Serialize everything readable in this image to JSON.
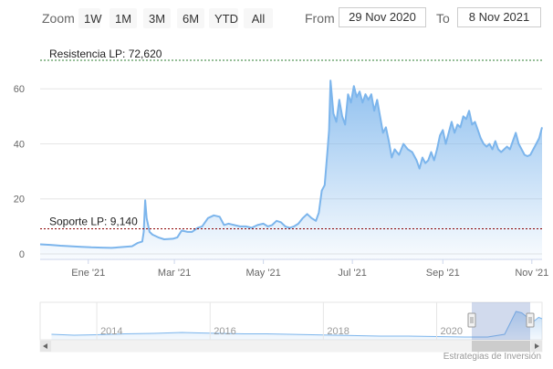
{
  "toolbar": {
    "zoom_label": "Zoom",
    "buttons": [
      "1W",
      "1M",
      "3M",
      "6M",
      "YTD",
      "All"
    ],
    "from_label": "From",
    "from_value": "29 Nov 2020",
    "to_label": "To",
    "to_value": "8 Nov 2021"
  },
  "annotations": {
    "resistance": {
      "label": "Resistencia LP: 72,620",
      "value": 72.62,
      "color": "#2e7d32"
    },
    "support": {
      "label": "Soporte LP: 9,140",
      "value": 9.14,
      "color": "#8b0000"
    }
  },
  "navigator": {
    "year_labels": [
      {
        "label": "2014",
        "year": 2014
      },
      {
        "label": "2016",
        "year": 2016
      },
      {
        "label": "2018",
        "year": 2018
      },
      {
        "label": "2020",
        "year": 2020
      }
    ],
    "history": [
      {
        "t": 2013.2,
        "v": 8
      },
      {
        "t": 2013.6,
        "v": 6
      },
      {
        "t": 2014.0,
        "v": 7
      },
      {
        "t": 2014.5,
        "v": 9
      },
      {
        "t": 2015.0,
        "v": 10
      },
      {
        "t": 2015.5,
        "v": 12
      },
      {
        "t": 2015.8,
        "v": 11
      },
      {
        "t": 2016.2,
        "v": 10
      },
      {
        "t": 2016.6,
        "v": 9
      },
      {
        "t": 2017.0,
        "v": 9
      },
      {
        "t": 2017.4,
        "v": 8
      },
      {
        "t": 2017.8,
        "v": 7
      },
      {
        "t": 2018.2,
        "v": 6
      },
      {
        "t": 2018.6,
        "v": 5
      },
      {
        "t": 2019.0,
        "v": 4
      },
      {
        "t": 2019.5,
        "v": 4
      },
      {
        "t": 2020.0,
        "v": 3
      },
      {
        "t": 2020.5,
        "v": 2
      },
      {
        "t": 2020.9,
        "v": 2
      },
      {
        "t": 2021.2,
        "v": 8
      },
      {
        "t": 2021.4,
        "v": 58
      },
      {
        "t": 2021.5,
        "v": 55
      },
      {
        "t": 2021.7,
        "v": 35
      },
      {
        "t": 2021.8,
        "v": 45
      },
      {
        "t": 2021.86,
        "v": 42
      }
    ]
  },
  "credit": "Estrategias de Inversión",
  "chart_data": {
    "type": "area",
    "x_ticks": [
      {
        "label": "Ene '21",
        "date": "2021-01-01"
      },
      {
        "label": "Mar '21",
        "date": "2021-03-01"
      },
      {
        "label": "May '21",
        "date": "2021-05-01"
      },
      {
        "label": "Jul '21",
        "date": "2021-07-01"
      },
      {
        "label": "Sep '21",
        "date": "2021-09-01"
      },
      {
        "label": "Nov '21",
        "date": "2021-11-01"
      }
    ],
    "y_ticks": [
      0,
      20,
      40,
      60
    ],
    "xlim": [
      "2020-11-29",
      "2021-11-08"
    ],
    "ylim": [
      0,
      75
    ],
    "grid": true,
    "color": "#7cb5ec",
    "points": [
      [
        "2020-11-29",
        3.5
      ],
      [
        "2020-12-06",
        3.3
      ],
      [
        "2020-12-13",
        3.0
      ],
      [
        "2020-12-20",
        2.8
      ],
      [
        "2020-12-27",
        2.6
      ],
      [
        "2021-01-03",
        2.4
      ],
      [
        "2021-01-10",
        2.3
      ],
      [
        "2021-01-17",
        2.2
      ],
      [
        "2021-01-24",
        2.5
      ],
      [
        "2021-01-31",
        2.8
      ],
      [
        "2021-02-04",
        4.0
      ],
      [
        "2021-02-07",
        4.5
      ],
      [
        "2021-02-08",
        8.0
      ],
      [
        "2021-02-09",
        19.5
      ],
      [
        "2021-02-10",
        13.0
      ],
      [
        "2021-02-12",
        8.0
      ],
      [
        "2021-02-14",
        7.0
      ],
      [
        "2021-02-18",
        6.0
      ],
      [
        "2021-02-22",
        5.3
      ],
      [
        "2021-02-28",
        5.5
      ],
      [
        "2021-03-03",
        6.0
      ],
      [
        "2021-03-06",
        8.5
      ],
      [
        "2021-03-10",
        8.0
      ],
      [
        "2021-03-13",
        8.0
      ],
      [
        "2021-03-17",
        9.5
      ],
      [
        "2021-03-20",
        10.0
      ],
      [
        "2021-03-24",
        13.0
      ],
      [
        "2021-03-28",
        14.0
      ],
      [
        "2021-04-01",
        13.5
      ],
      [
        "2021-04-04",
        10.5
      ],
      [
        "2021-04-07",
        11.0
      ],
      [
        "2021-04-11",
        10.5
      ],
      [
        "2021-04-15",
        10.0
      ],
      [
        "2021-04-19",
        10.0
      ],
      [
        "2021-04-23",
        9.5
      ],
      [
        "2021-04-27",
        10.5
      ],
      [
        "2021-05-01",
        11.0
      ],
      [
        "2021-05-04",
        10.0
      ],
      [
        "2021-05-07",
        10.5
      ],
      [
        "2021-05-10",
        12.0
      ],
      [
        "2021-05-13",
        11.5
      ],
      [
        "2021-05-16",
        10.0
      ],
      [
        "2021-05-19",
        9.5
      ],
      [
        "2021-05-22",
        10.0
      ],
      [
        "2021-05-25",
        11.0
      ],
      [
        "2021-05-28",
        13.0
      ],
      [
        "2021-05-31",
        14.5
      ],
      [
        "2021-06-03",
        13.0
      ],
      [
        "2021-06-06",
        12.0
      ],
      [
        "2021-06-08",
        15.0
      ],
      [
        "2021-06-10",
        23.0
      ],
      [
        "2021-06-12",
        25.0
      ],
      [
        "2021-06-14",
        38.0
      ],
      [
        "2021-06-15",
        45.0
      ],
      [
        "2021-06-16",
        63.0
      ],
      [
        "2021-06-18",
        51.0
      ],
      [
        "2021-06-20",
        48.0
      ],
      [
        "2021-06-22",
        56.0
      ],
      [
        "2021-06-24",
        50.0
      ],
      [
        "2021-06-26",
        47.0
      ],
      [
        "2021-06-28",
        58.0
      ],
      [
        "2021-06-30",
        55.0
      ],
      [
        "2021-07-02",
        61.0
      ],
      [
        "2021-07-04",
        57.0
      ],
      [
        "2021-07-06",
        59.0
      ],
      [
        "2021-07-08",
        55.0
      ],
      [
        "2021-07-10",
        58.0
      ],
      [
        "2021-07-12",
        56.0
      ],
      [
        "2021-07-14",
        58.0
      ],
      [
        "2021-07-16",
        52.0
      ],
      [
        "2021-07-18",
        56.0
      ],
      [
        "2021-07-20",
        50.0
      ],
      [
        "2021-07-22",
        44.0
      ],
      [
        "2021-07-24",
        46.0
      ],
      [
        "2021-07-26",
        41.0
      ],
      [
        "2021-07-28",
        35.0
      ],
      [
        "2021-07-30",
        38.0
      ],
      [
        "2021-08-02",
        36.0
      ],
      [
        "2021-08-05",
        40.0
      ],
      [
        "2021-08-08",
        38.0
      ],
      [
        "2021-08-11",
        37.0
      ],
      [
        "2021-08-14",
        34.0
      ],
      [
        "2021-08-16",
        31.0
      ],
      [
        "2021-08-18",
        35.0
      ],
      [
        "2021-08-20",
        33.0
      ],
      [
        "2021-08-22",
        34.0
      ],
      [
        "2021-08-24",
        37.0
      ],
      [
        "2021-08-26",
        34.0
      ],
      [
        "2021-08-28",
        38.0
      ],
      [
        "2021-08-30",
        43.0
      ],
      [
        "2021-09-01",
        45.0
      ],
      [
        "2021-09-03",
        40.0
      ],
      [
        "2021-09-05",
        44.0
      ],
      [
        "2021-09-07",
        48.0
      ],
      [
        "2021-09-09",
        44.0
      ],
      [
        "2021-09-11",
        47.0
      ],
      [
        "2021-09-13",
        46.0
      ],
      [
        "2021-09-15",
        50.0
      ],
      [
        "2021-09-17",
        49.0
      ],
      [
        "2021-09-19",
        52.0
      ],
      [
        "2021-09-21",
        47.0
      ],
      [
        "2021-09-23",
        48.0
      ],
      [
        "2021-09-25",
        45.0
      ],
      [
        "2021-09-27",
        42.0
      ],
      [
        "2021-09-29",
        40.0
      ],
      [
        "2021-10-01",
        39.0
      ],
      [
        "2021-10-03",
        40.0
      ],
      [
        "2021-10-05",
        38.0
      ],
      [
        "2021-10-07",
        41.0
      ],
      [
        "2021-10-09",
        38.0
      ],
      [
        "2021-10-11",
        37.0
      ],
      [
        "2021-10-13",
        38.0
      ],
      [
        "2021-10-15",
        39.0
      ],
      [
        "2021-10-17",
        38.0
      ],
      [
        "2021-10-19",
        41.0
      ],
      [
        "2021-10-21",
        44.0
      ],
      [
        "2021-10-23",
        40.0
      ],
      [
        "2021-10-25",
        38.0
      ],
      [
        "2021-10-27",
        36.0
      ],
      [
        "2021-10-29",
        35.5
      ],
      [
        "2021-10-31",
        36.0
      ],
      [
        "2021-11-02",
        38.0
      ],
      [
        "2021-11-04",
        40.0
      ],
      [
        "2021-11-06",
        42.0
      ],
      [
        "2021-11-07",
        44.0
      ],
      [
        "2021-11-08",
        46.0
      ]
    ]
  }
}
